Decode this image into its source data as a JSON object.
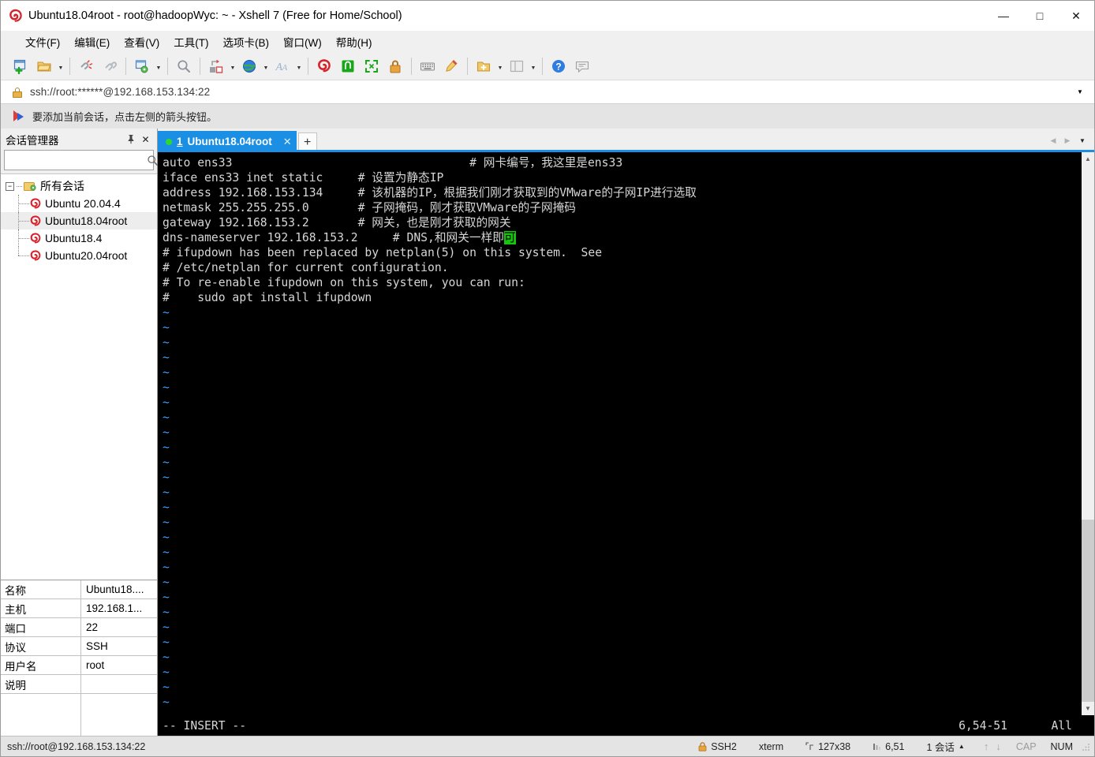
{
  "window": {
    "title": "Ubuntu18.04root - root@hadoopWyc: ~ - Xshell 7 (Free for Home/School)",
    "app_icon": "xshell-spiral-icon",
    "minimize": "—",
    "maximize": "□",
    "close": "✕"
  },
  "menubar": {
    "items": [
      {
        "label": "文件(F)",
        "name": "menu-file"
      },
      {
        "label": "编辑(E)",
        "name": "menu-edit"
      },
      {
        "label": "查看(V)",
        "name": "menu-view"
      },
      {
        "label": "工具(T)",
        "name": "menu-tools"
      },
      {
        "label": "选项卡(B)",
        "name": "menu-tabs"
      },
      {
        "label": "窗口(W)",
        "name": "menu-window"
      },
      {
        "label": "帮助(H)",
        "name": "menu-help"
      }
    ]
  },
  "toolbar": {
    "icons": [
      "new-session-icon",
      "open-folder-icon",
      "disconnect-icon",
      "reconnect-icon",
      "session-properties-icon",
      "find-icon",
      "transfer-file-icon",
      "globe-icon",
      "font-icon",
      "xshell-icon",
      "xftp-icon",
      "fullscreen-icon",
      "lock-icon",
      "keyboard-icon",
      "highlight-icon",
      "new-folder-icon",
      "layout-icon",
      "help-icon",
      "comment-icon"
    ]
  },
  "address_bar": {
    "icon": "lock-icon",
    "value": "ssh://root:******@192.168.153.134:22",
    "dropdown": "▼"
  },
  "notice_bar": {
    "icon": "flag-icon",
    "text": "要添加当前会话，点击左侧的箭头按钮。"
  },
  "sidebar": {
    "title": "会话管理器",
    "pin_icon": "pin-icon",
    "close_icon": "close-icon",
    "search": {
      "value": "",
      "placeholder": "",
      "icon": "search-icon"
    },
    "tree": {
      "root": {
        "label": "所有会话",
        "toggle": "−",
        "icon": "folder-icon"
      },
      "children": [
        {
          "label": "Ubuntu 20.04.4",
          "icon": "session-icon",
          "selected": false
        },
        {
          "label": "Ubuntu18.04root",
          "icon": "session-icon",
          "selected": true
        },
        {
          "label": "Ubuntu18.4",
          "icon": "session-icon",
          "selected": false
        },
        {
          "label": "Ubuntu20.04root",
          "icon": "session-icon",
          "selected": false
        }
      ]
    },
    "properties": [
      {
        "key": "名称",
        "value": "Ubuntu18...."
      },
      {
        "key": "主机",
        "value": "192.168.1..."
      },
      {
        "key": "端口",
        "value": "22"
      },
      {
        "key": "协议",
        "value": "SSH"
      },
      {
        "key": "用户名",
        "value": "root"
      },
      {
        "key": "说明",
        "value": ""
      }
    ]
  },
  "tabbar": {
    "tabs": [
      {
        "num": "1",
        "label": "Ubuntu18.04root",
        "status_dot": "#2fd82f",
        "close": "✕",
        "active": true
      }
    ],
    "add_label": "+",
    "nav_prev": "◀",
    "nav_next": "▶",
    "menu": "▼"
  },
  "terminal": {
    "lines": [
      {
        "segments": [
          {
            "text": "auto ens33",
            "style": "white"
          },
          {
            "text": "                                  # 网卡编号，我这里是ens33",
            "style": "white"
          }
        ]
      },
      {
        "segments": [
          {
            "text": "iface ens33 inet static     # 设置为静态IP",
            "style": "white"
          }
        ]
      },
      {
        "segments": [
          {
            "text": "address 192.168.153.134     # 该机器的IP，根据我们刚才获取到的VMware的子网IP进行选取",
            "style": "white"
          }
        ]
      },
      {
        "segments": [
          {
            "text": "netmask 255.255.255.0       # 子网掩码，刚才获取VMware的子网掩码",
            "style": "white"
          }
        ]
      },
      {
        "segments": [
          {
            "text": "gateway 192.168.153.2       # 网关，也是刚才获取的网关",
            "style": "white"
          }
        ]
      },
      {
        "segments": [
          {
            "text": "dns-nameserver 192.168.153.2     # DNS,和网关一样即",
            "style": "white"
          },
          {
            "text": "可",
            "style": "cursor"
          }
        ]
      },
      {
        "segments": [
          {
            "text": "# ifupdown has been replaced by netplan(5) on this system.  See",
            "style": "white"
          }
        ]
      },
      {
        "segments": [
          {
            "text": "# /etc/netplan for current configuration.",
            "style": "white"
          }
        ]
      },
      {
        "segments": [
          {
            "text": "# To re-enable ifupdown on this system, you can run:",
            "style": "white"
          }
        ]
      },
      {
        "segments": [
          {
            "text": "#    sudo apt install ifupdown",
            "style": "white"
          }
        ]
      }
    ],
    "empty_marker": "~",
    "empty_lines": 27,
    "status": {
      "mode": "-- INSERT --",
      "position": "6,54-51",
      "scroll": "All"
    },
    "scrollbar": {
      "up": "▲",
      "down": "▼"
    }
  },
  "statusbar": {
    "url": "ssh://root@192.168.153.134:22",
    "security": "SSH2",
    "security_icon": "lock-icon",
    "term_type": "xterm",
    "size": "127x38",
    "size_icon": "size-icon",
    "cursor": "6,51",
    "cursor_icon": "cursor-icon",
    "sessions": "1 会话",
    "sessions_arrow": "▲",
    "up_arrow": "↑",
    "down_arrow": "↓",
    "cap": "CAP",
    "num": "NUM"
  },
  "colors": {
    "accent": "#1a8fe3",
    "terminal_bg": "#000000",
    "terminal_fg": "#d6d6d6",
    "tilde": "#3b9dff",
    "cursor": "#16c60c",
    "chrome": "#f0f0f0"
  }
}
